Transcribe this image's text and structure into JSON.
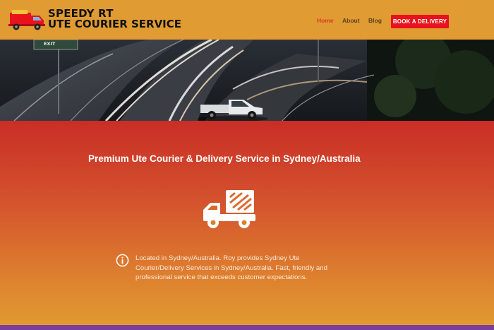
{
  "brand": {
    "line1": "SPEEDY RT",
    "line2": "UTE COURIER SERVICE"
  },
  "nav": {
    "home": "Home",
    "about": "About",
    "blog": "Blog",
    "cta": "BOOK A DELIVERY"
  },
  "hero": {
    "sign_text": "EXIT"
  },
  "main": {
    "headline": "Premium Ute Courier & Delivery Service in Sydney/Australia",
    "description": "Located in Sydney/Australia. Roy provides Sydney Ute Courier/Delivery Services in Sydney/Australia. Fast, friendly and professional service that exceeds customer expectations."
  },
  "colors": {
    "header_bg": "#e09b32",
    "nav_active": "#d93a24",
    "cta_bg": "#e8121c",
    "section_top": "#c92e26",
    "section_bottom": "#e19a30",
    "bottom_bar": "#7a3e9c"
  },
  "icons": [
    "truck-logo-icon",
    "delivery-truck-icon",
    "info-icon"
  ]
}
